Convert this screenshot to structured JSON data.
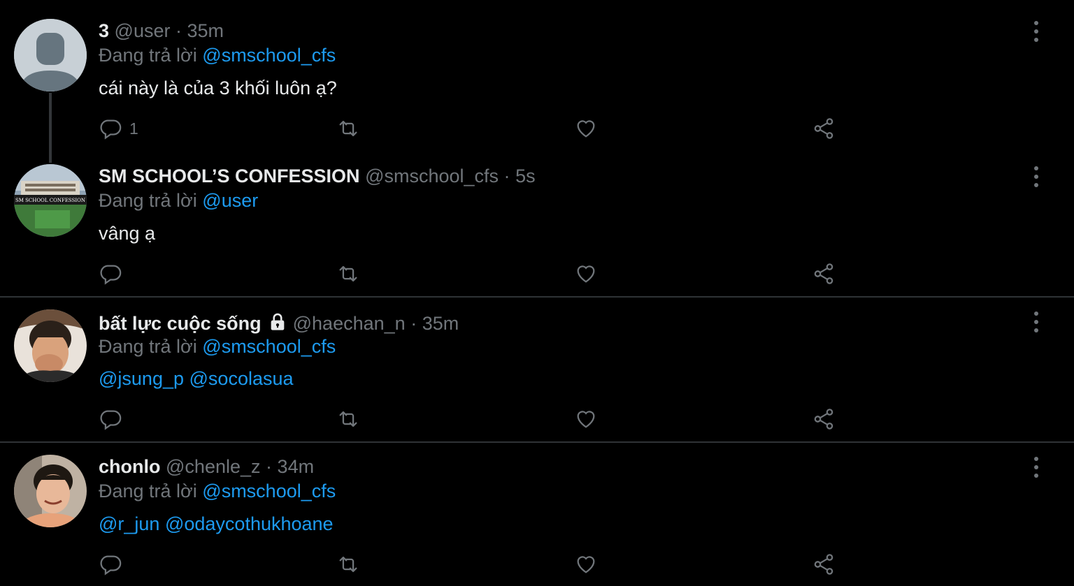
{
  "tweets": [
    {
      "name": "3",
      "handle": "@user",
      "dot": "·",
      "time": "35m",
      "replying_prefix": "Đang trả lời",
      "replying_to": "@smschool_cfs",
      "text": "cái này là của 3 khối luôn ạ?",
      "reply_count": "1",
      "avatar": "default-avatar"
    },
    {
      "name": "SM SCHOOL’S CONFESSION",
      "handle": "@smschool_cfs",
      "dot": "·",
      "time": "5s",
      "replying_prefix": "Đang trả lời",
      "replying_to": "@user",
      "text": "vâng ạ",
      "avatar": "school-photo",
      "avatar_caption": "SM SCHOOL CONFESSION"
    },
    {
      "name": "bất lực cuộc sống",
      "handle": "@haechan_n",
      "dot": "·",
      "time": "35m",
      "replying_prefix": "Đang trả lời",
      "replying_to": "@smschool_cfs",
      "mentions": [
        "@jsung_p",
        "@socolasua"
      ],
      "avatar": "person-photo"
    },
    {
      "name": "chonlo",
      "handle": "@chenle_z",
      "dot": "·",
      "time": "34m",
      "replying_prefix": "Đang trả lời",
      "replying_to": "@smschool_cfs",
      "mentions": [
        "@r_jun",
        "@odaycothukhoane"
      ],
      "avatar": "person-photo"
    }
  ],
  "icons": {
    "reply": "reply-icon",
    "retweet": "retweet-icon",
    "like": "like-icon",
    "share": "share-icon",
    "more": "more-icon",
    "lock": "lock-icon"
  },
  "colors": {
    "background": "#000000",
    "text": "#e7e9ea",
    "secondary": "#71767b",
    "accent": "#1d9bf0",
    "divider": "#2f3336"
  }
}
